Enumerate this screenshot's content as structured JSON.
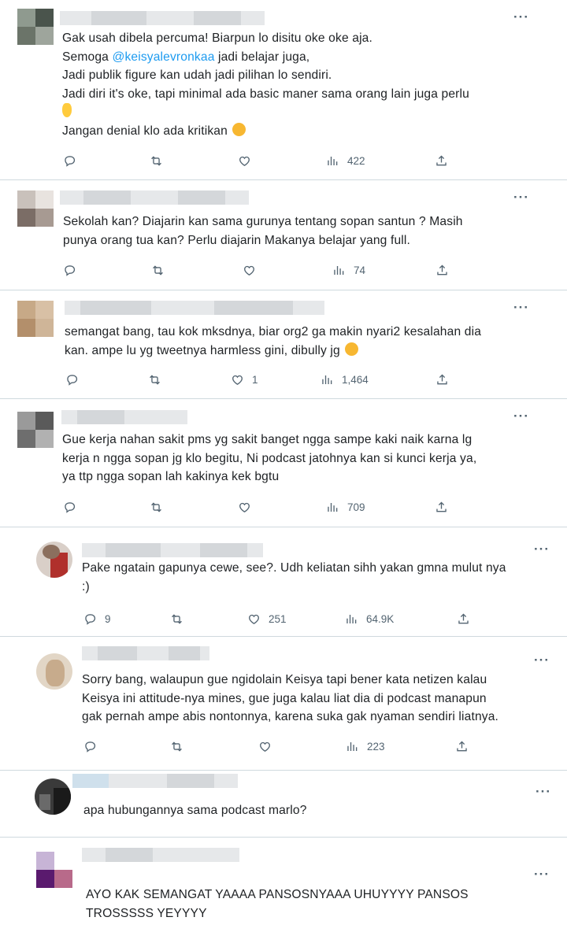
{
  "tweets": [
    {
      "lines": [
        "Gak usah dibela percuma! Biarpun lo disitu oke oke aja."
      ],
      "line2_pre": "Semoga ",
      "line2_mention": "@keisyalevronkaa",
      "line2_post": " jadi belajar juga,",
      "rest": [
        "Jadi publik figure kan udah jadi pilihan lo sendiri.",
        "Jadi diri it's oke, tapi minimal ada basic maner sama orang lain juga perlu"
      ],
      "last": "Jangan denial klo ada kritikan",
      "stats": {
        "replies": "",
        "retweets": "",
        "likes": "",
        "views": "422"
      }
    },
    {
      "lines": [
        "Sekolah kan? Diajarin kan sama gurunya tentang sopan santun ? Masih",
        "punya orang tua kan? Perlu diajarin Makanya belajar yang full."
      ],
      "stats": {
        "replies": "",
        "retweets": "",
        "likes": "",
        "views": "74"
      }
    },
    {
      "lines": [
        "semangat bang, tau kok mksdnya, biar org2 ga makin nyari2 kesalahan dia",
        "kan. ampe lu yg tweetnya harmless gini, dibully jg"
      ],
      "stats": {
        "replies": "",
        "retweets": "",
        "likes": "1",
        "views": "1,464"
      }
    },
    {
      "lines": [
        "Gue kerja nahan sakit pms yg sakit banget ngga sampe kaki naik karna lg",
        "kerja n ngga sopan jg klo begitu, Ni podcast jatohnya kan si kunci kerja ya,",
        "ya ttp ngga sopan lah kakinya kek bgtu"
      ],
      "stats": {
        "replies": "",
        "retweets": "",
        "likes": "",
        "views": "709"
      }
    },
    {
      "lines": [
        "Pake ngatain gapunya cewe, see?. Udh keliatan sihh yakan gmna mulut nya",
        ":)"
      ],
      "stats": {
        "replies": "9",
        "retweets": "",
        "likes": "251",
        "views": "64.9K"
      }
    },
    {
      "lines": [
        "Sorry bang, walaupun gue ngidolain Keisya tapi bener kata netizen kalau",
        "Keisya ini attitude-nya mines, gue juga kalau liat dia di podcast manapun",
        "gak pernah ampe abis nontonnya, karena suka gak nyaman sendiri liatnya."
      ],
      "stats": {
        "replies": "",
        "retweets": "",
        "likes": "",
        "views": "223"
      }
    },
    {
      "lines": [
        "apa hubungannya sama podcast marlo?"
      ]
    },
    {
      "lines": [
        "AYO KAK SEMANGAT YAAAA PANSOSNYAAA UHUYYYY PANSOS",
        "TROSSSSS YEYYYY"
      ]
    }
  ],
  "icons": {
    "reply": "reply-icon",
    "retweet": "retweet-icon",
    "like": "heart-icon",
    "views": "views-icon",
    "share": "share-icon",
    "more": "more-icon"
  },
  "colors": {
    "mention": "#1d9bf0",
    "icon": "#536471",
    "divider": "#cfd9de"
  }
}
